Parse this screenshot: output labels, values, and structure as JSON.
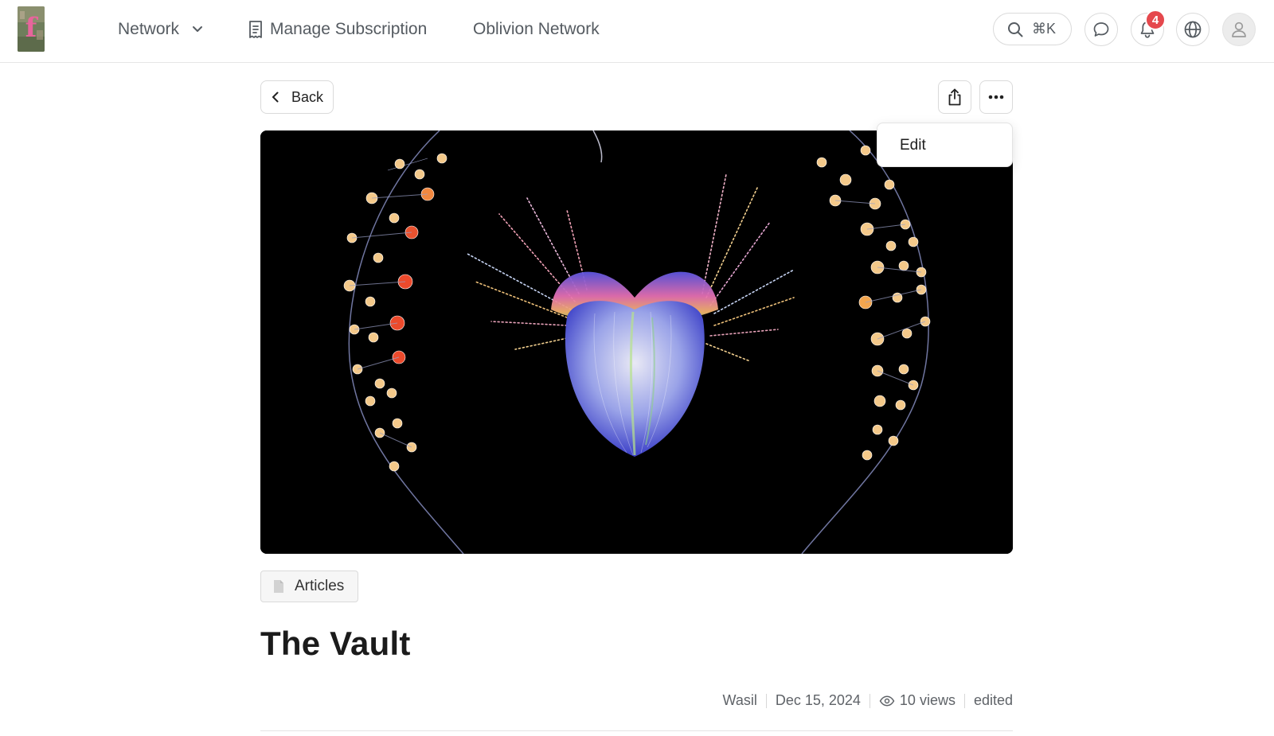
{
  "header": {
    "logo_icon": "community-logo",
    "nav": {
      "network_label": "Network",
      "manage_label": "Manage Subscription",
      "oblivion_label": "Oblivion Network"
    },
    "search_shortcut": "⌘K",
    "notifications_count": "4",
    "icons": [
      "search-icon",
      "chat-icon",
      "bell-icon",
      "globe-icon",
      "user-icon"
    ]
  },
  "toolbar": {
    "back_label": "Back",
    "menu": {
      "items": [
        "Edit"
      ]
    }
  },
  "post": {
    "category_label": "Articles",
    "title": "The Vault",
    "author": "Wasil",
    "date": "Dec 15, 2024",
    "views": "10 views",
    "status": "edited"
  },
  "colors": {
    "badge": "#e5484d",
    "border": "#dadada",
    "text_muted": "#5f6368"
  }
}
